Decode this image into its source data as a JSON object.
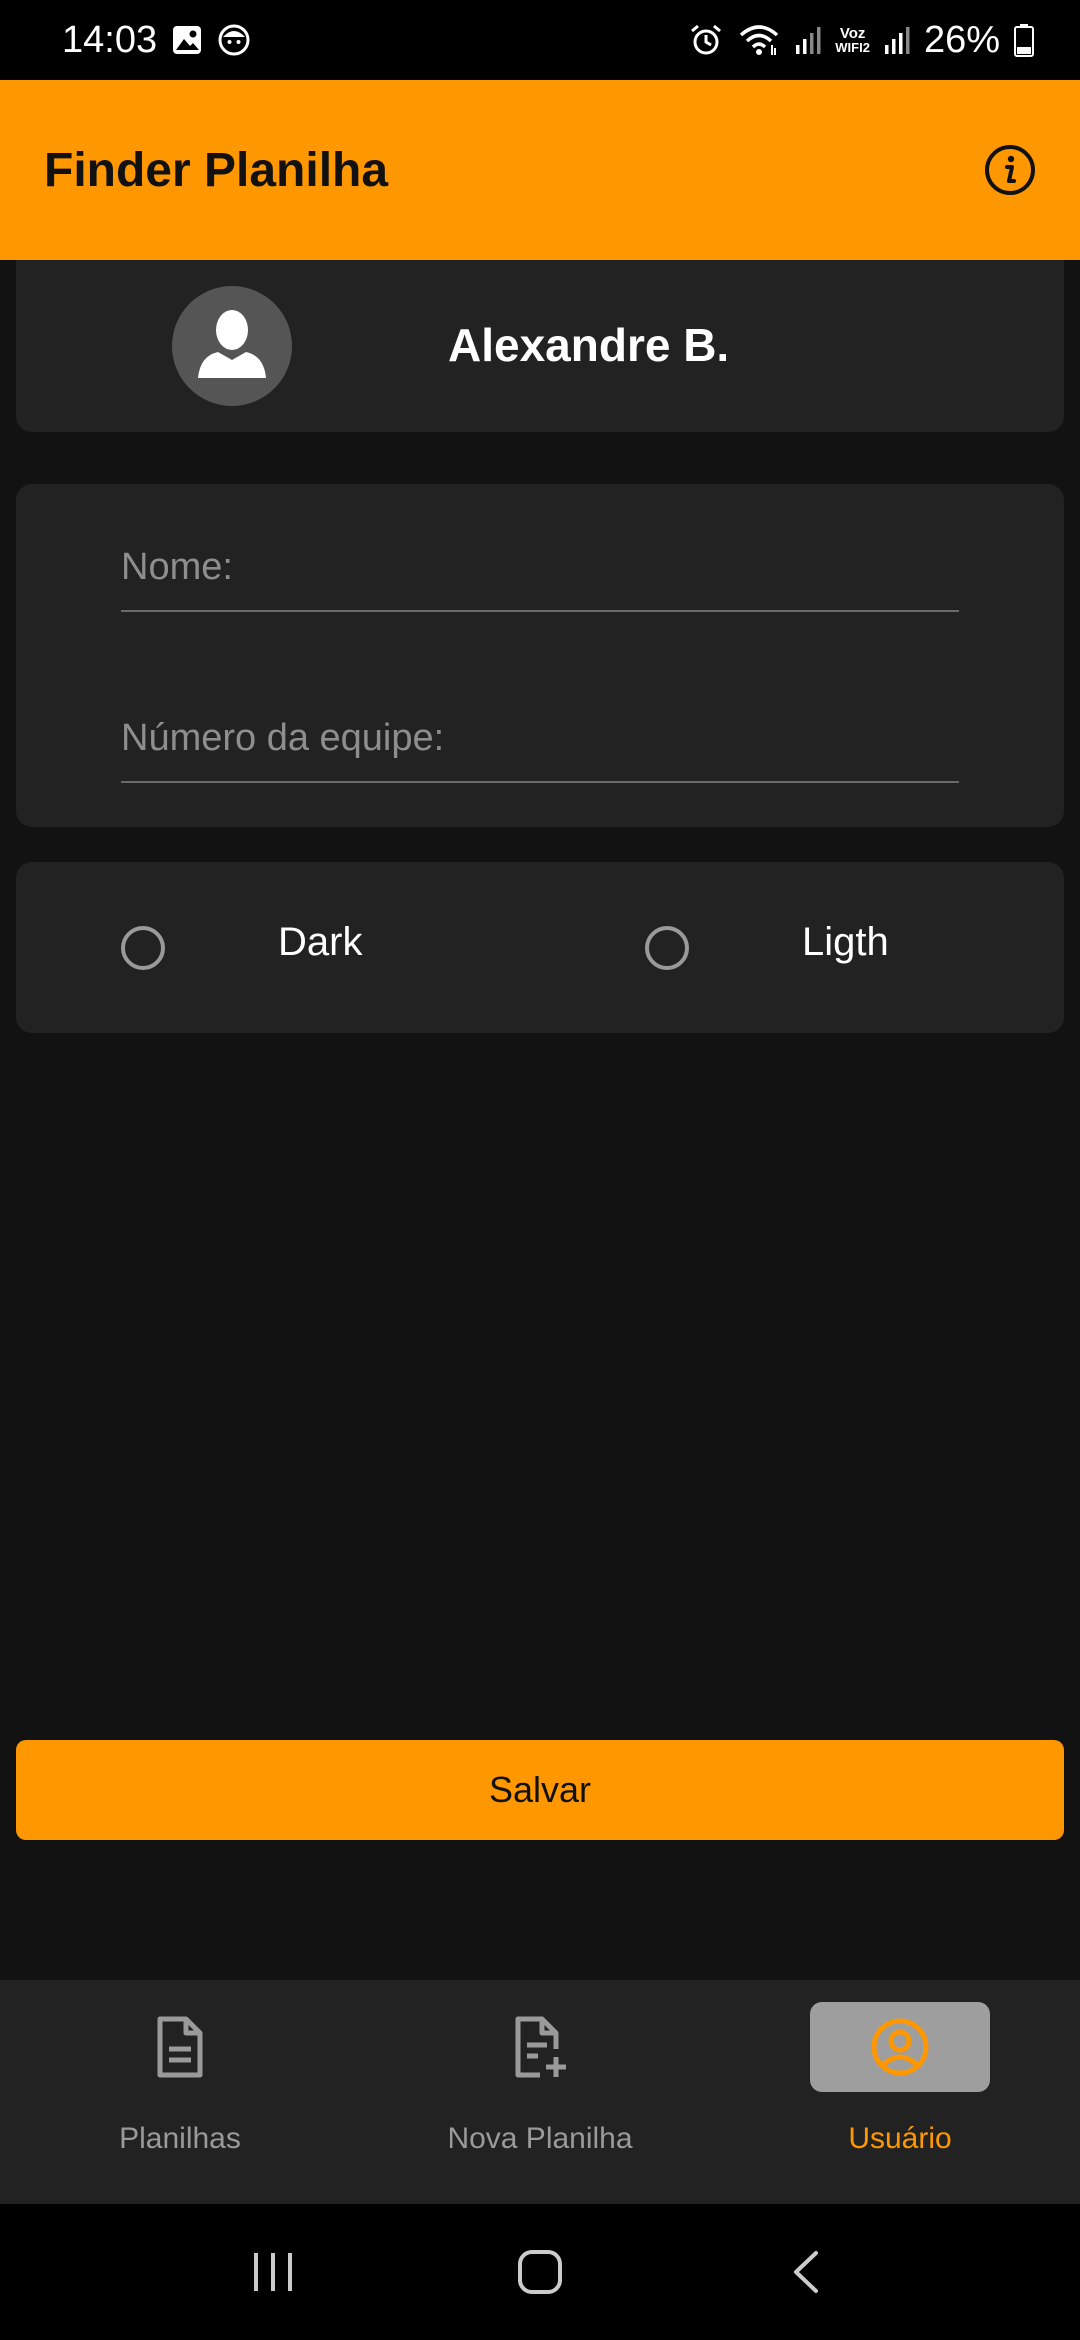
{
  "status_bar": {
    "time": "14:03",
    "battery": "26%",
    "left_icons": [
      "gallery-icon",
      "face-notification-icon"
    ],
    "right_icons": [
      "alarm-icon",
      "wifi-icon",
      "signal-icon",
      "voz-wifi-icon",
      "signal-icon",
      "battery-icon"
    ],
    "voz_label": "Voz",
    "wifi_label": "WIFI2"
  },
  "app_bar": {
    "title": "Finder Planilha",
    "info_icon": "info-icon"
  },
  "profile": {
    "name": "Alexandre B.",
    "avatar_icon": "person-avatar-icon"
  },
  "form": {
    "name_value": "",
    "name_placeholder": "Nome:",
    "team_value": "",
    "team_placeholder": "Número da equipe:"
  },
  "theme": {
    "options": [
      {
        "label": "Dark",
        "selected": false
      },
      {
        "label": "Ligth",
        "selected": false
      }
    ]
  },
  "save_button": {
    "label": "Salvar"
  },
  "bottom_nav": {
    "items": [
      {
        "label": "Planilhas",
        "icon": "document-icon",
        "active": false
      },
      {
        "label": "Nova Planilha",
        "icon": "document-add-icon",
        "active": false
      },
      {
        "label": "Usuário",
        "icon": "user-circle-icon",
        "active": true
      }
    ]
  },
  "colors": {
    "accent": "#FF9800",
    "background": "#121212",
    "card": "#222222",
    "active_nav_bg": "#9E9E9E"
  }
}
